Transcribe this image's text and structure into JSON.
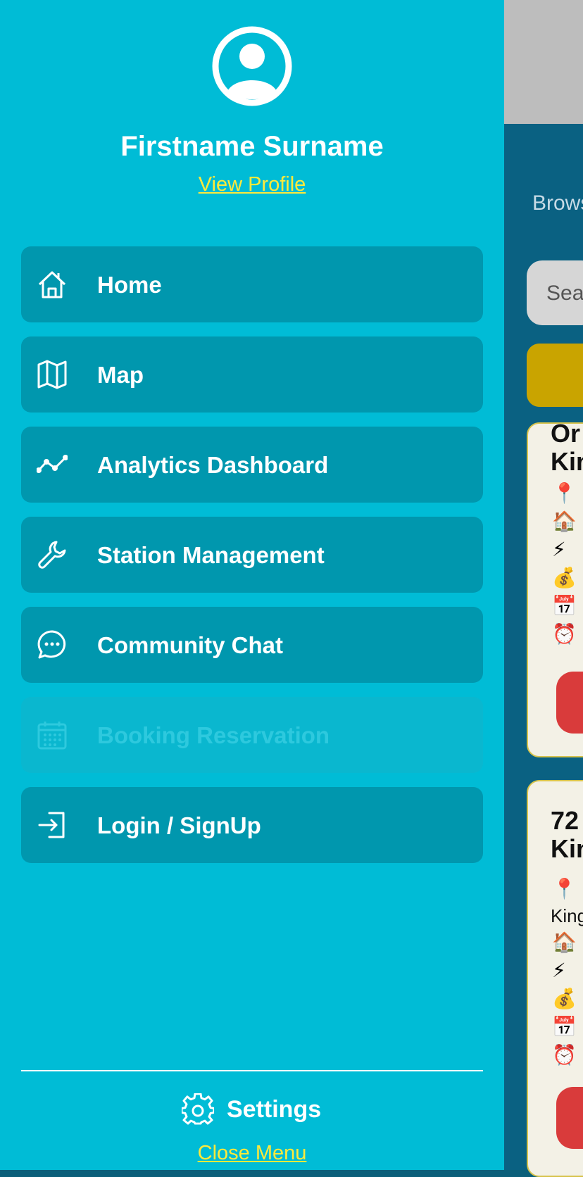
{
  "drawer": {
    "user_name": "Firstname Surname",
    "view_profile_label": "View Profile",
    "items": [
      {
        "label": "Home",
        "icon": "home-icon",
        "enabled": true
      },
      {
        "label": "Map",
        "icon": "map-icon",
        "enabled": true
      },
      {
        "label": "Analytics Dashboard",
        "icon": "trend-line-icon",
        "enabled": true
      },
      {
        "label": "Station Management",
        "icon": "wrench-icon",
        "enabled": true
      },
      {
        "label": "Community Chat",
        "icon": "chat-bubble-icon",
        "enabled": true
      },
      {
        "label": "Booking Reservation",
        "icon": "calendar-icon",
        "enabled": false
      },
      {
        "label": "Login / SignUp",
        "icon": "login-icon",
        "enabled": true
      }
    ],
    "settings_label": "Settings",
    "close_menu_label": "Close Menu"
  },
  "background": {
    "browse_text": "Brows",
    "search_placeholder": "Sea",
    "card1": {
      "title_line1": "Or",
      "title_line2": "Kin",
      "icons": [
        "📍",
        "🏠",
        "⚡",
        "💰",
        "📅",
        "⏰"
      ]
    },
    "card2": {
      "title_line1": "72",
      "title_line2": "Kin",
      "address_fragment": "King",
      "icons": [
        "📍",
        "🏠",
        "⚡",
        "💰",
        "📅",
        "⏰"
      ]
    }
  },
  "colors": {
    "drawer_bg": "#00bcd6",
    "menu_item_bg": "#0097ae",
    "link_yellow": "#ffea3a",
    "app_bg": "#0a6182"
  }
}
